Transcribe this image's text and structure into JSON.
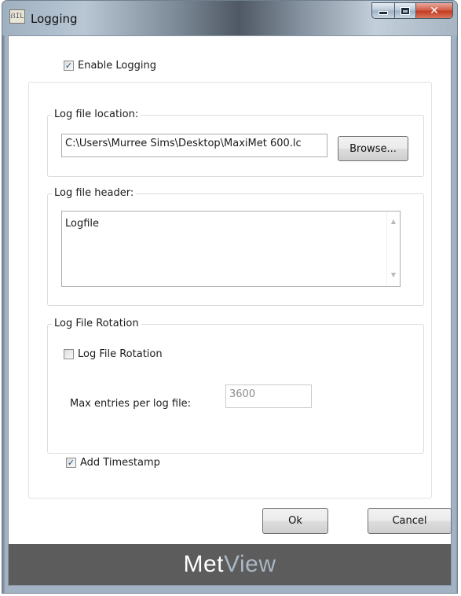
{
  "window": {
    "title": "Logging",
    "app_icon_text": "ẞIL",
    "buttons": [
      "minimize",
      "maximize",
      "close"
    ]
  },
  "enable_logging": {
    "label": "Enable Logging",
    "checked": true
  },
  "log_location": {
    "group_title": "Log file location:",
    "path_value": "C:\\Users\\Murree Sims\\Desktop\\MaxiMet 600.lc",
    "browse_label": "Browse..."
  },
  "log_header": {
    "group_title": "Log file header:",
    "value": "Logfile"
  },
  "rotation": {
    "group_title": "Log File Rotation",
    "checkbox_label": "Log File Rotation",
    "checked": false,
    "max_entries_label": "Max entries per log file:",
    "max_entries_value": "3600"
  },
  "timestamp": {
    "label": "Add Timestamp",
    "checked": true
  },
  "actions": {
    "ok_label": "Ok",
    "cancel_label": "Cancel"
  },
  "banner": {
    "part1": "Met",
    "part2": "View"
  },
  "colors": {
    "banner_bg": "#5c5c5c",
    "banner_accent": "#aab7c4",
    "close_button": "#c23c22",
    "check_mark": "#2a4d8f"
  }
}
